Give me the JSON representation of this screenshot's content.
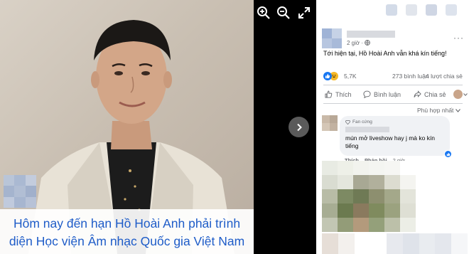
{
  "viewer": {
    "caption_line1": "Hôm nay đến hạn Hồ Hoài Anh phải trình",
    "caption_line2": "diện Học viện Âm nhạc Quốc gia Việt Nam",
    "icons": [
      "zoom-in-icon",
      "zoom-out-icon",
      "fullscreen-icon",
      "chevron-right-icon"
    ]
  },
  "post": {
    "time": "2 giờ ·",
    "text": "Tới hiện tại, Hồ Hoài Anh vẫn khá kín tiếng!",
    "menu": "···",
    "reaction_count": "5,7K",
    "comments": "273 bình luận",
    "shares": "4 lượt chia sẻ",
    "actions": {
      "like": "Thích",
      "comment": "Bình luận",
      "share": "Chia sẻ"
    },
    "sort": "Phù hợp nhất"
  },
  "comment": {
    "badge": "Fan cứng",
    "text": "mún mở liveshow hay j mà ko kín tiếng",
    "like": "Thích",
    "reply": "Phản hồi",
    "time": "2 giờ"
  },
  "colors": {
    "caption_text": "#1e5cc8",
    "facebook_blue": "#1877f2",
    "muted": "#65676b"
  }
}
